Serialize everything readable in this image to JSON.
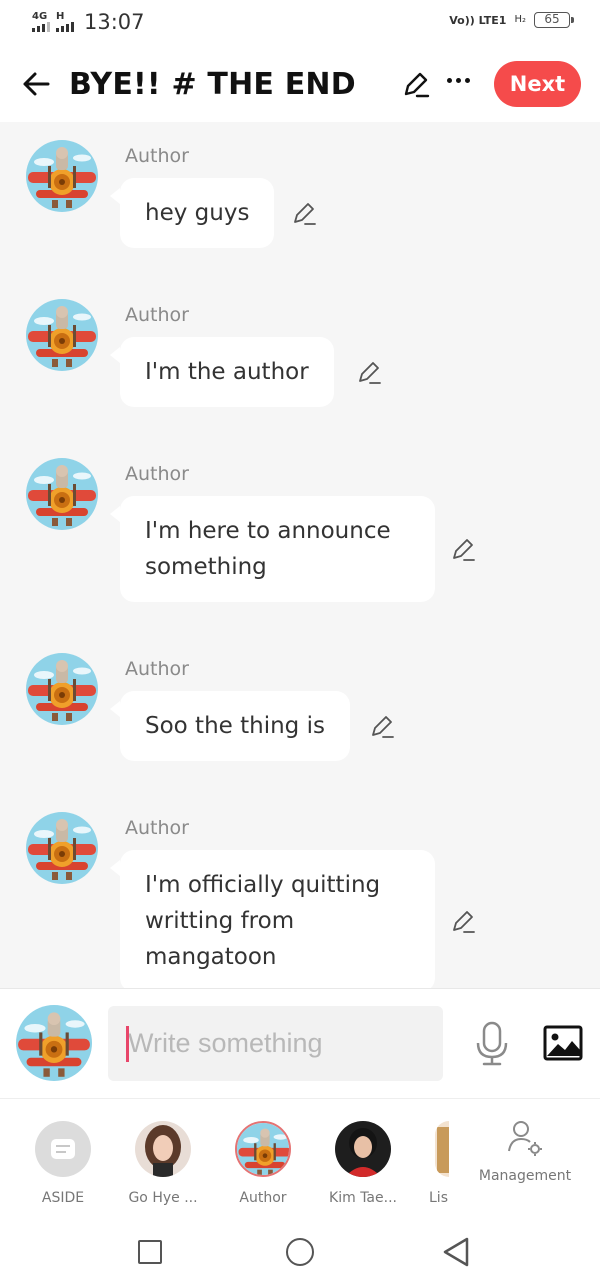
{
  "status_bar": {
    "network1": "4G",
    "network2": "H",
    "time": "13:07",
    "volte": "Vo)) LTE1",
    "h2": "H₂",
    "battery": "65"
  },
  "header": {
    "title": "BYE!! # THE END",
    "next_label": "Next"
  },
  "messages": [
    {
      "author": "Author",
      "lines": [
        "hey guys"
      ]
    },
    {
      "author": "Author",
      "lines": [
        "I'm the author"
      ]
    },
    {
      "author": "Author",
      "lines": [
        "I'm here to announce",
        "something"
      ]
    },
    {
      "author": "Author",
      "lines": [
        "Soo the thing is"
      ]
    },
    {
      "author": "Author",
      "lines": [
        "I'm officially quitting",
        "writting from",
        "mangatoon"
      ]
    }
  ],
  "input": {
    "placeholder": "Write something"
  },
  "characters": [
    {
      "name": "ASIDE"
    },
    {
      "name": "Go Hye ..."
    },
    {
      "name": "Author"
    },
    {
      "name": "Kim Tae..."
    },
    {
      "name": "Lis"
    }
  ],
  "management_label": "Management",
  "colors": {
    "accent": "#f54b4b",
    "background": "#f6f6f6",
    "caret": "#e8466a"
  }
}
